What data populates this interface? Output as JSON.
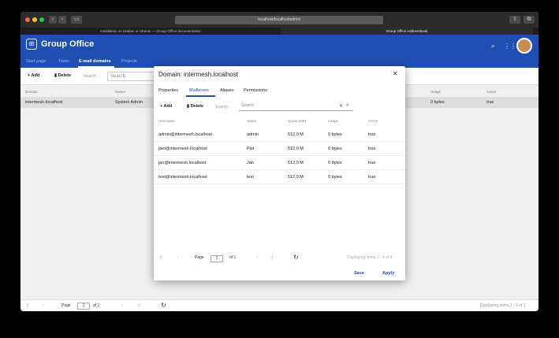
{
  "browser": {
    "url": "localhost/localhostadmin",
    "tabs": [
      "Installation on Debian or Ubuntu — Group-Office documentation",
      "Group Office Addressbook"
    ]
  },
  "app": {
    "title": "Group Office",
    "logo_glyph": "⊞",
    "nav": [
      "Start page",
      "Tasks",
      "E-mail domains",
      "Projects"
    ],
    "active_nav": "E-mail domains"
  },
  "toolbar": {
    "add_label": "Add",
    "delete_label": "Delete",
    "search_label": "Search",
    "search_placeholder": "Search"
  },
  "table": {
    "columns": [
      "Domain",
      "Owner",
      "Usage",
      "Active"
    ],
    "rows": [
      {
        "domain": "intermesh.localhost",
        "owner": "System Admin",
        "usage": "0 bytes",
        "active": "true"
      }
    ]
  },
  "pager": {
    "page_label": "Page",
    "page_value": "1",
    "of_label": "of 1",
    "display": "Displaying items 1 - 1 of 1"
  },
  "dialog": {
    "title": "Domain: intermesh.localhost",
    "tabs": [
      "Properties",
      "Mailboxes",
      "Aliases",
      "Permissions"
    ],
    "active_tab": "Mailboxes",
    "toolbar": {
      "add_label": "Add",
      "delete_label": "Delete",
      "search_label": "Search",
      "search_placeholder": "Search"
    },
    "columns": [
      "Username",
      "Name",
      "Quota (MB)",
      "Usage",
      "Active"
    ],
    "rows": [
      {
        "username": "admin@intermesh.localhost",
        "name": "admin",
        "quota": "512,0 M",
        "usage": "0 bytes",
        "active": "true"
      },
      {
        "username": "piet@intermesh.localhost",
        "name": "Piet",
        "quota": "512,0 M",
        "usage": "0 bytes",
        "active": "true"
      },
      {
        "username": "jan@intermesh.localhost",
        "name": "Jan",
        "quota": "512,0 M",
        "usage": "0 bytes",
        "active": "true"
      },
      {
        "username": "test@intermesh.localhost",
        "name": "test",
        "quota": "512,0 M",
        "usage": "0 bytes",
        "active": "true"
      }
    ],
    "pager": {
      "page_label": "Page",
      "page_value": "1",
      "of_label": "of 1",
      "display": "Displaying items 1 - 4 of 4"
    },
    "save_label": "Save",
    "apply_label": "Apply"
  },
  "colors": {
    "brand": "#1f4fb2",
    "selected_row": "#dedede"
  },
  "icons": [
    "search-icon",
    "grid-icon",
    "close-icon",
    "refresh-icon",
    "trash-icon",
    "plus-icon",
    "clear-icon"
  ]
}
